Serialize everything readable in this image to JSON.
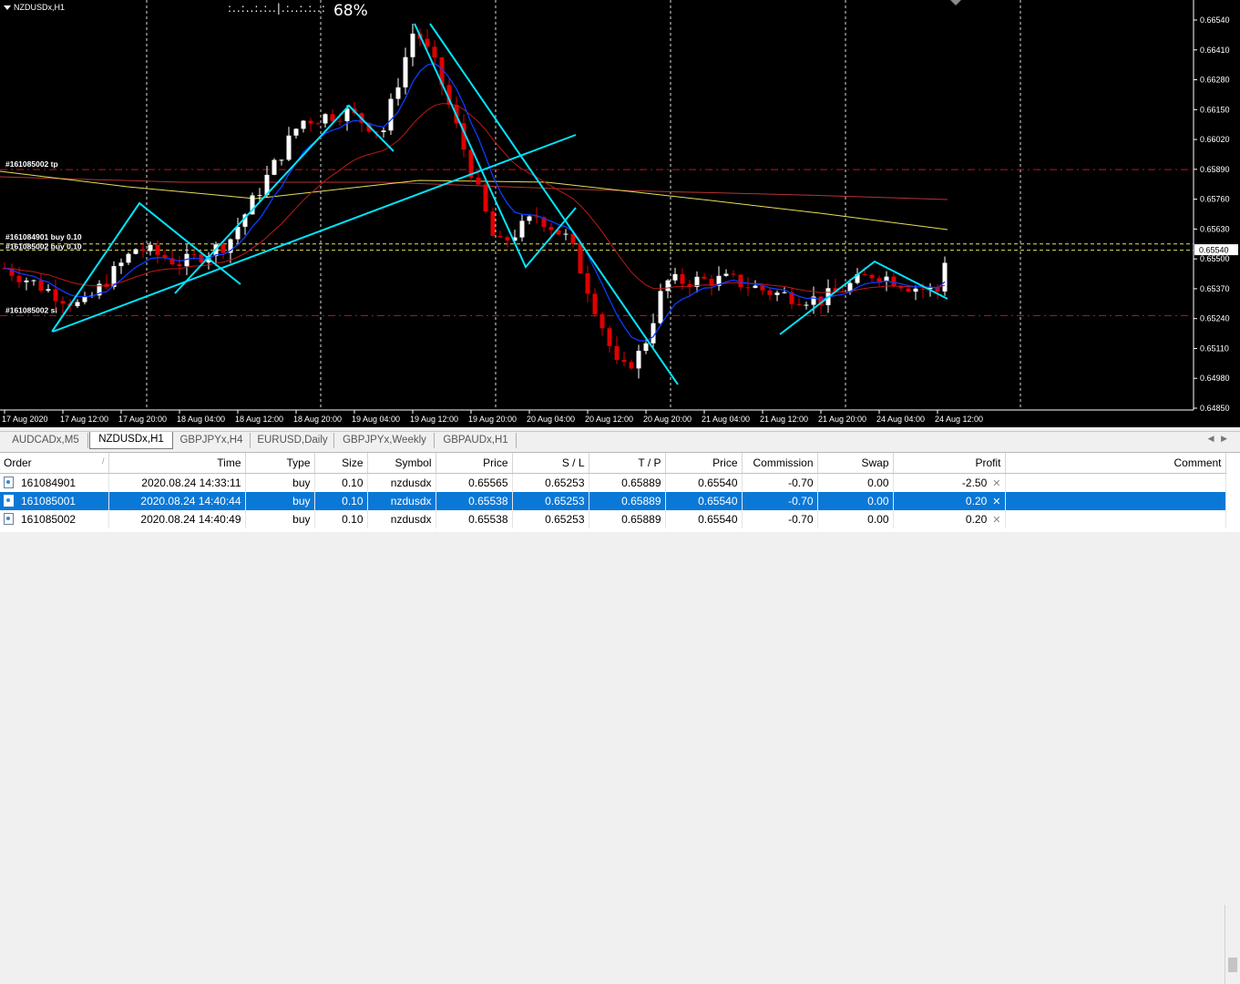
{
  "chart": {
    "title": "NZDUSDx,H1",
    "progress_dots": ":..:..:.:..|.:..:.:..:",
    "progress_pct": "68%",
    "current_price": "0.65540",
    "price_ticks": [
      "0.66540",
      "0.66410",
      "0.66280",
      "0.66150",
      "0.66020",
      "0.65890",
      "0.65760",
      "0.65630",
      "0.65500",
      "0.65370",
      "0.65240",
      "0.65110",
      "0.64980",
      "0.64850"
    ],
    "time_labels": [
      "17 Aug 2020",
      "17 Aug 12:00",
      "17 Aug 20:00",
      "18 Aug 04:00",
      "18 Aug 12:00",
      "18 Aug 20:00",
      "19 Aug 04:00",
      "19 Aug 12:00",
      "19 Aug 20:00",
      "20 Aug 04:00",
      "20 Aug 12:00",
      "20 Aug 20:00",
      "21 Aug 04:00",
      "21 Aug 12:00",
      "21 Aug 20:00",
      "24 Aug 04:00",
      "24 Aug 12:00"
    ],
    "order_labels": {
      "tp": "#161085002 tp",
      "buy1": "#161084901 buy 0.10",
      "buy2": "#161085002 buy 0.10",
      "sl": "#161085002 sl"
    },
    "colors": {
      "bull": "#ffffff",
      "bear": "#e00000",
      "trendline": "#00e5ff",
      "ma_fast": "#0b3cff",
      "ma_mid": "#c01818",
      "ma_slow_red": "#b83232",
      "ma_slow_yellow": "#e5e05a"
    }
  },
  "tabs": [
    "AUDCADx,M5",
    "NZDUSDx,H1",
    "GBPJPYx,H4",
    "EURUSD,Daily",
    "GBPJPYx,Weekly",
    "GBPAUDx,H1"
  ],
  "active_tab": "NZDUSDx,H1",
  "table": {
    "headers": [
      "Order",
      "Time",
      "Type",
      "Size",
      "Symbol",
      "Price",
      "S / L",
      "T / P",
      "Price",
      "Commission",
      "Swap",
      "Profit",
      "Comment"
    ],
    "rows": [
      {
        "order": "161084901",
        "time": "2020.08.24 14:33:11",
        "type": "buy",
        "size": "0.10",
        "symbol": "nzdusdx",
        "price": "0.65565",
        "sl": "0.65253",
        "tp": "0.65889",
        "cur": "0.65540",
        "commission": "-0.70",
        "swap": "0.00",
        "profit": "-2.50"
      },
      {
        "order": "161085001",
        "time": "2020.08.24 14:40:44",
        "type": "buy",
        "size": "0.10",
        "symbol": "nzdusdx",
        "price": "0.65538",
        "sl": "0.65253",
        "tp": "0.65889",
        "cur": "0.65540",
        "commission": "-0.70",
        "swap": "0.00",
        "profit": "0.20"
      },
      {
        "order": "161085002",
        "time": "2020.08.24 14:40:49",
        "type": "buy",
        "size": "0.10",
        "symbol": "nzdusdx",
        "price": "0.65538",
        "sl": "0.65253",
        "tp": "0.65889",
        "cur": "0.65540",
        "commission": "-0.70",
        "swap": "0.00",
        "profit": "0.20"
      }
    ]
  }
}
